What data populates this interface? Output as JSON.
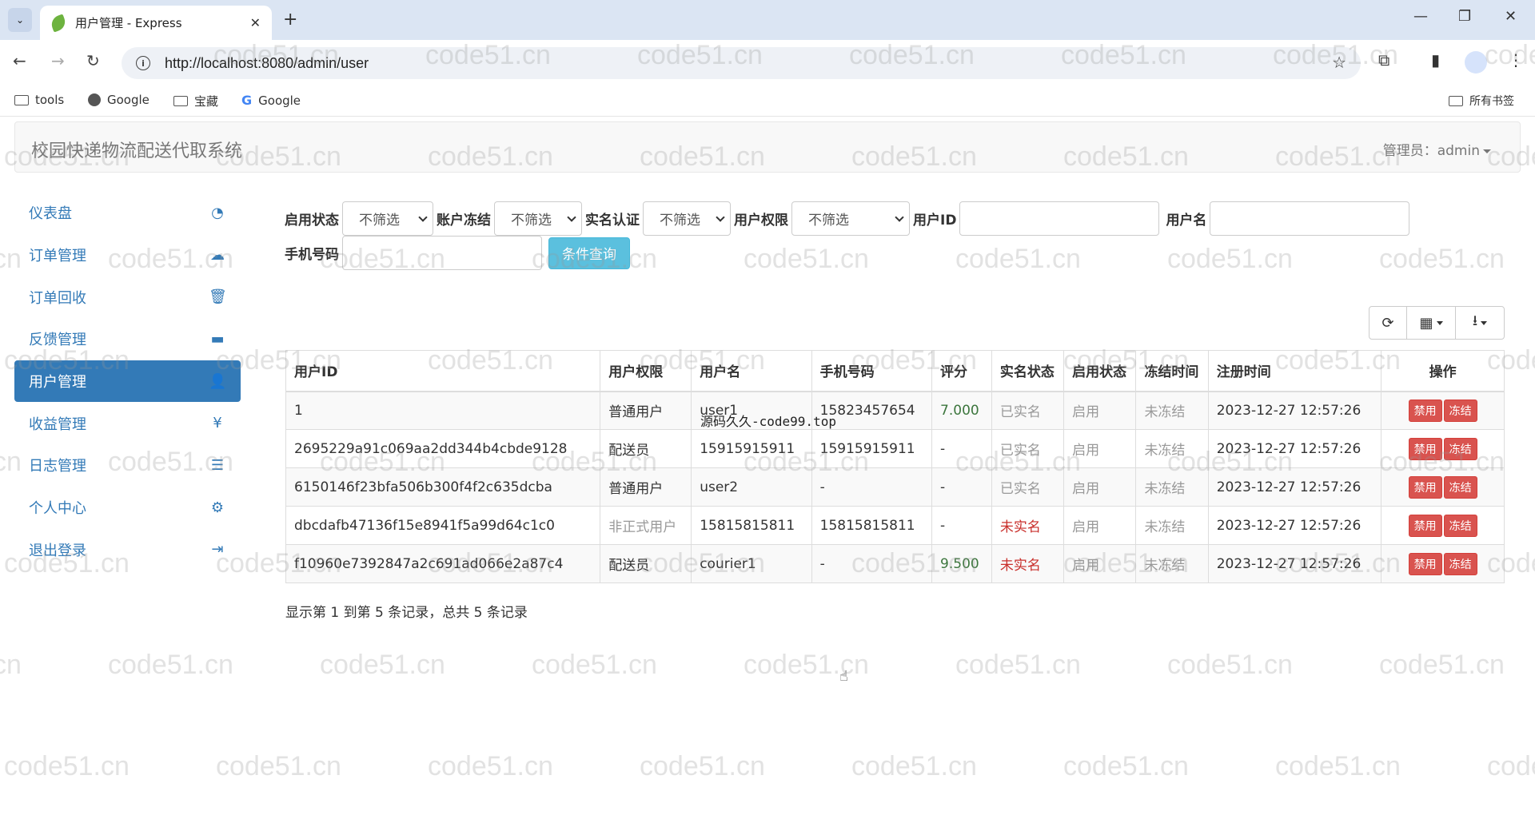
{
  "browser": {
    "tab_title": "用户管理 - Express",
    "url": "http://localhost:8080/admin/user",
    "bookmarks": [
      {
        "label": "tools",
        "icon": "folder-icon"
      },
      {
        "label": "Google",
        "icon": "globe-icon"
      },
      {
        "label": "宝藏",
        "icon": "folder-icon"
      },
      {
        "label": "Google",
        "icon": "google-icon"
      }
    ],
    "all_bookmarks": "所有书签"
  },
  "header": {
    "brand": "校园快递物流配送代取系统",
    "admin_label": "管理员：admin"
  },
  "sidebar": {
    "items": [
      {
        "label": "仪表盘",
        "icon": "dashboard-icon",
        "glyph": "◔"
      },
      {
        "label": "订单管理",
        "icon": "cloud-upload-icon",
        "glyph": "☁"
      },
      {
        "label": "订单回收",
        "icon": "trash-icon",
        "glyph": "🗑"
      },
      {
        "label": "反馈管理",
        "icon": "comment-icon",
        "glyph": "▬"
      },
      {
        "label": "用户管理",
        "icon": "user-icon",
        "glyph": "👤"
      },
      {
        "label": "收益管理",
        "icon": "yen-icon",
        "glyph": "¥"
      },
      {
        "label": "日志管理",
        "icon": "list-icon",
        "glyph": "☰"
      },
      {
        "label": "个人中心",
        "icon": "gear-icon",
        "glyph": "⚙"
      },
      {
        "label": "退出登录",
        "icon": "logout-icon",
        "glyph": "⇥"
      }
    ],
    "active_index": 4
  },
  "filters": {
    "enable_label": "启用状态",
    "enable_value": "不筛选",
    "frozen_label": "账户冻结",
    "frozen_value": "不筛选",
    "realname_label": "实名认证",
    "realname_value": "不筛选",
    "role_label": "用户权限",
    "role_value": "不筛选",
    "userid_label": "用户ID",
    "userid_value": "",
    "username_label": "用户名",
    "username_value": "",
    "phone_label": "手机号码",
    "phone_value": "",
    "query_button": "条件查询"
  },
  "table": {
    "columns": [
      "用户ID",
      "用户权限",
      "用户名",
      "手机号码",
      "评分",
      "实名状态",
      "启用状态",
      "冻结时间",
      "注册时间",
      "操作"
    ],
    "rows": [
      {
        "id": "1",
        "role": "普通用户",
        "username": "user1",
        "phone": "15823457654",
        "score": "7.000",
        "realname": "已实名",
        "enabled": "启用",
        "freeze": "未冻结",
        "registered": "2023-12-27 12:57:26",
        "btn1": "禁用",
        "btn2": "冻结"
      },
      {
        "id": "2695229a91c069aa2dd344b4cbde9128",
        "role": "配送员",
        "username": "15915915911",
        "phone": "15915915911",
        "score": "-",
        "realname": "已实名",
        "enabled": "启用",
        "freeze": "未冻结",
        "registered": "2023-12-27 12:57:26",
        "btn1": "禁用",
        "btn2": "冻结"
      },
      {
        "id": "6150146f23bfa506b300f4f2c635dcba",
        "role": "普通用户",
        "username": "user2",
        "phone": "-",
        "score": "-",
        "realname": "已实名",
        "enabled": "启用",
        "freeze": "未冻结",
        "registered": "2023-12-27 12:57:26",
        "btn1": "禁用",
        "btn2": "冻结"
      },
      {
        "id": "dbcdafb47136f15e8941f5a99d64c1c0",
        "role": "非正式用户",
        "username": "15815815811",
        "phone": "15815815811",
        "score": "-",
        "realname": "未实名",
        "enabled": "启用",
        "freeze": "未冻结",
        "registered": "2023-12-27 12:57:26",
        "btn1": "禁用",
        "btn2": "冻结"
      },
      {
        "id": "f10960e7392847a2c691ad066e2a87c4",
        "role": "配送员",
        "username": "courier1",
        "phone": "-",
        "score": "9.500",
        "realname": "未实名",
        "enabled": "启用",
        "freeze": "未冻结",
        "registered": "2023-12-27 12:57:26",
        "btn1": "禁用",
        "btn2": "冻结"
      }
    ]
  },
  "pagination": "显示第 1 到第 5 条记录，总共 5 条记录",
  "overlay_note": "源码久久-code99.top",
  "watermark": "code51.cn",
  "colors": {
    "primary": "#337ab7",
    "info": "#5bc0de",
    "danger": "#d9534f",
    "score_green": "#3c763d",
    "unverified_red": "#c9302c"
  }
}
